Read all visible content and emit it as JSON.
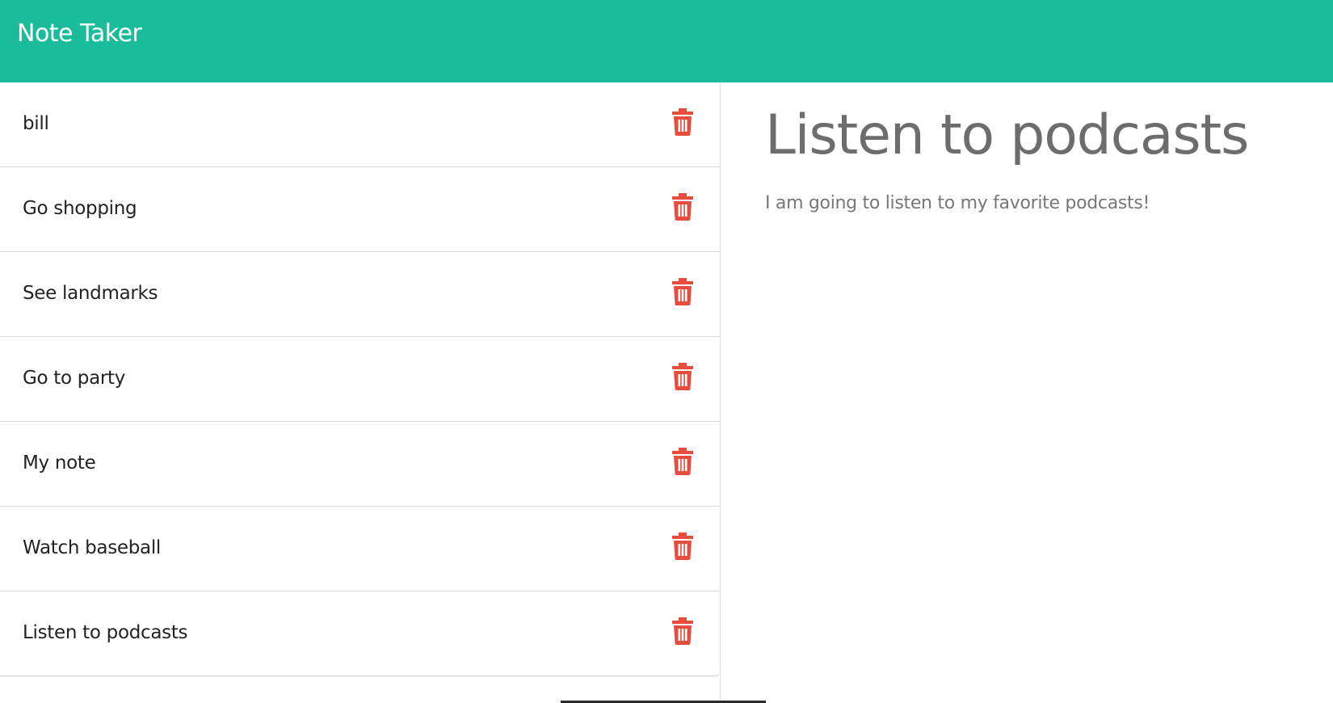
{
  "navbar": {
    "title": "Note Taker"
  },
  "notes": {
    "items": [
      {
        "title": "bill",
        "delete_icon": "trash-icon"
      },
      {
        "title": "Go shopping",
        "delete_icon": "trash-icon"
      },
      {
        "title": "See landmarks",
        "delete_icon": "trash-icon"
      },
      {
        "title": "Go to party",
        "delete_icon": "trash-icon"
      },
      {
        "title": "My note",
        "delete_icon": "trash-icon"
      },
      {
        "title": "Watch baseball",
        "delete_icon": "trash-icon"
      },
      {
        "title": "Listen to podcasts",
        "delete_icon": "trash-icon"
      }
    ]
  },
  "active_note": {
    "title": "Listen to podcasts",
    "text": "I am going to listen to my favorite podcasts!"
  },
  "colors": {
    "navbar": "#1abc9c",
    "delete_icon": "#e74c3c",
    "detail_title": "#6d6d6d",
    "detail_text": "#777777"
  }
}
